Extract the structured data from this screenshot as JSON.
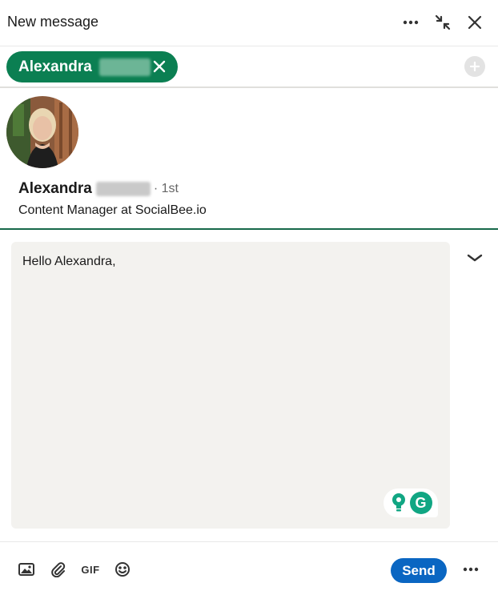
{
  "header": {
    "title": "New message",
    "icons": [
      "more-icon",
      "collapse-icon",
      "close-icon"
    ]
  },
  "recipient": {
    "chip_name": "Alexandra",
    "add_icon": "plus-icon"
  },
  "profile": {
    "name": "Alexandra",
    "degree": "· 1st",
    "headline": "Content Manager at SocialBee.io"
  },
  "compose": {
    "text": "Hello Alexandra,",
    "grammarly_logo": "G"
  },
  "footer": {
    "gif_label": "GIF",
    "send_label": "Send",
    "icons": [
      "image-icon",
      "attachment-icon",
      "gif-icon",
      "emoji-icon",
      "more-icon"
    ]
  },
  "colors": {
    "chip_bg": "#0b7f52",
    "send_bg": "#0a66c2",
    "compose_bg": "#f3f2ef",
    "profile_divider": "#17694a",
    "grammarly": "#11a683"
  }
}
